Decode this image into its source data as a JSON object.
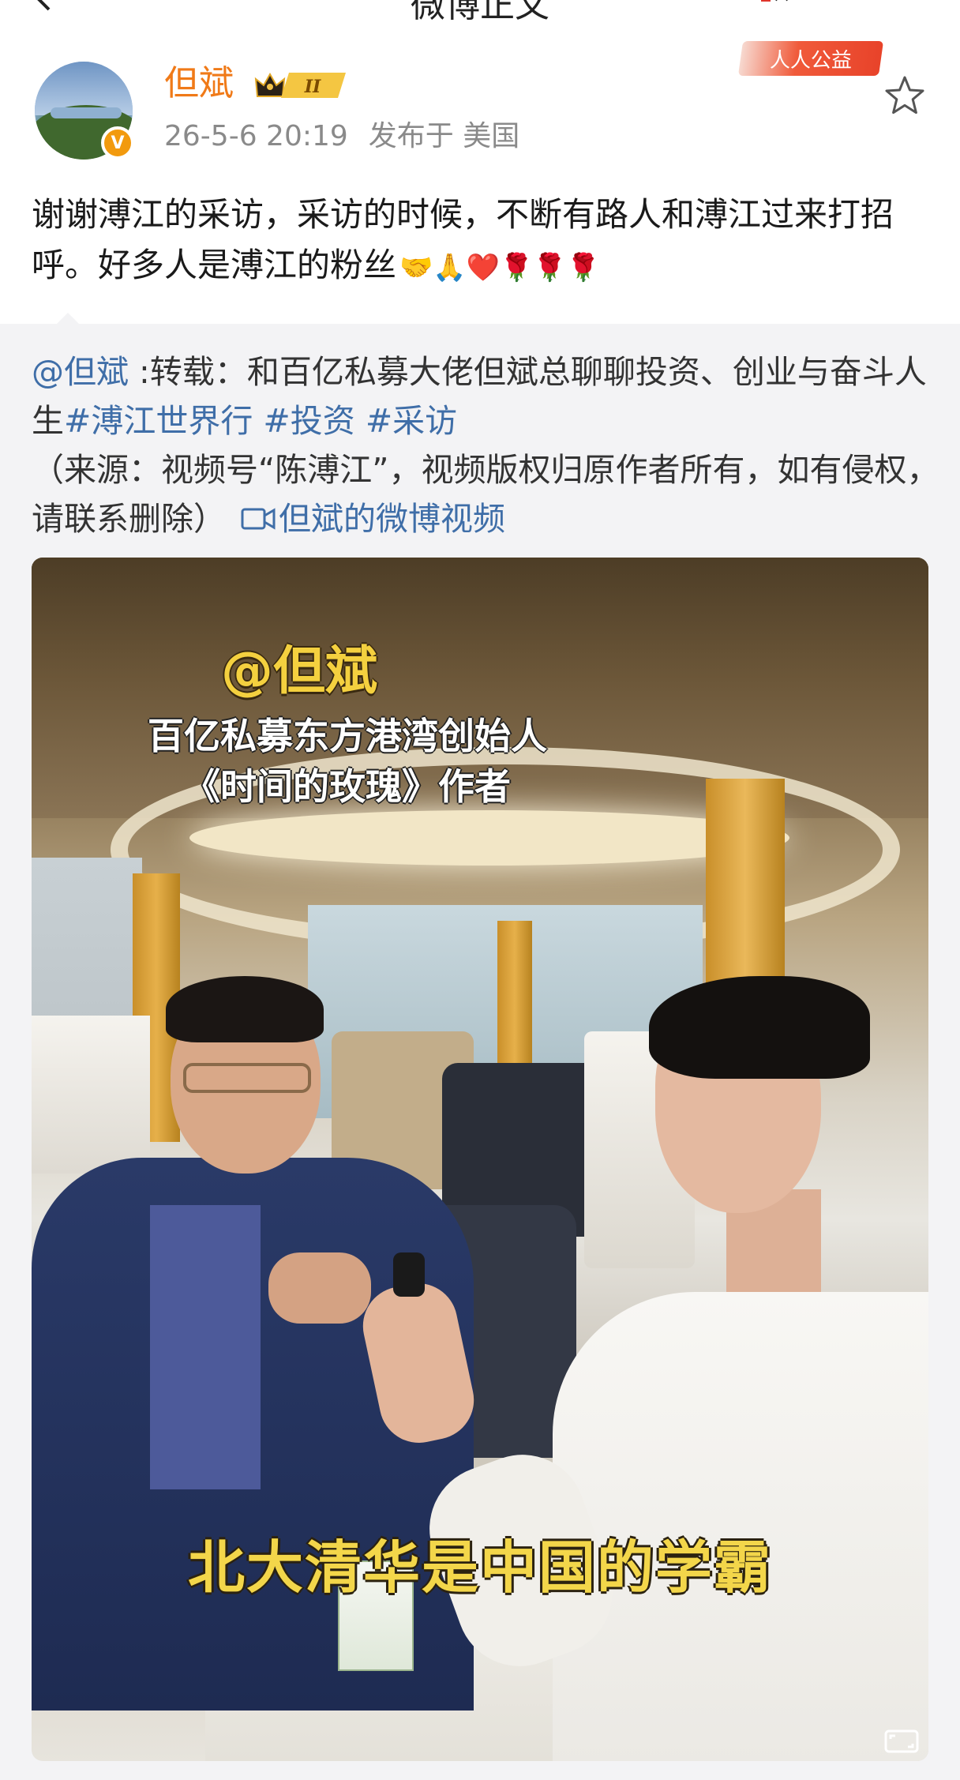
{
  "nav": {
    "title": "微博正文",
    "back_icon": "chevron-left-icon",
    "more_icon": "more-icon"
  },
  "author": {
    "name": "但斌",
    "level_badge": "II",
    "verified_badge": "V",
    "time": "26-5-6 20:19",
    "location": "发布于 美国",
    "public_welfare_badge": "人人公益",
    "colors": {
      "name": "#f07a18",
      "verified": "#f29a0e"
    }
  },
  "post": {
    "text": "谢谢溥江的采访，采访的时候，不断有路人和溥江过来打招呼。好多人是溥江的粉丝",
    "emojis": "🤝🙏❤️🌹🌹🌹"
  },
  "repost": {
    "mention": "@但斌",
    "intro": " :转载：和百亿私募大佬但斌总聊聊投资、创业与奋斗人生",
    "tag1": "#溥江世界行",
    "tag2": "#投资",
    "tag3": "#采访",
    "source": "（来源：视频号“陈溥江”，视频版权归原作者所有，如有侵权，请联系删除）",
    "video_link": "但斌的微博视频",
    "link_color": "#3f6ea8"
  },
  "video": {
    "caption_name": "@但斌",
    "caption_line1": "百亿私募东方港湾创始人",
    "caption_line2": "《时间的玫瑰》作者",
    "subtitle": "北大清华是中国的学霸"
  }
}
